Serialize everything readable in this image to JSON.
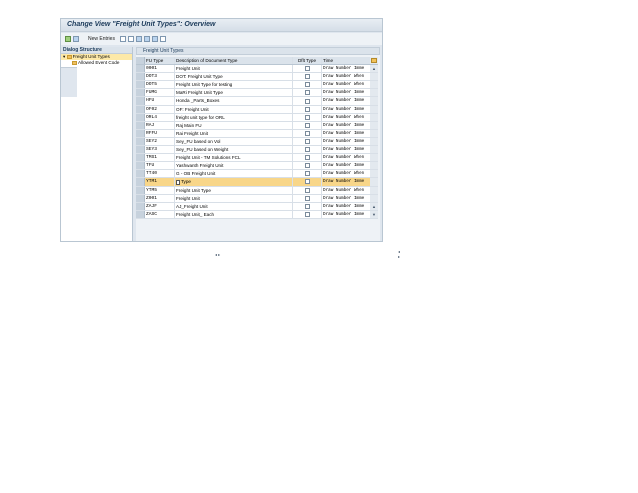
{
  "window": {
    "title": "Change View \"Freight Unit Types\": Overview"
  },
  "toolbar": {
    "new_entries": "New Entries"
  },
  "dialog": {
    "header": "Dialog Structure",
    "items": [
      {
        "label": "Freight Unit Types"
      },
      {
        "label": "Allowed Event Code"
      }
    ]
  },
  "table": {
    "title": "Freight Unit Types",
    "columns": {
      "code": "FU Type",
      "desc": "Description of Document Type",
      "dflt": "Dflt Type",
      "time": "Time"
    },
    "rows": [
      {
        "code": "0001",
        "desc": "Freight Unit",
        "time": "Draw Number Imme",
        "scroll": "▲"
      },
      {
        "code": "DOT3",
        "desc": "DOT: Freight Unit Type",
        "time": "Draw Number When",
        "scroll": ""
      },
      {
        "code": "DOT5",
        "desc": "Freight Unit Type for testing",
        "time": "Draw Number When",
        "scroll": ""
      },
      {
        "code": "FUMG",
        "desc": "MaRi Freight Unit Type",
        "time": "Draw Number Imme",
        "scroll": ""
      },
      {
        "code": "HFU",
        "desc": "Honda _Parts_Boxes",
        "time": "Draw Number Imme",
        "scroll": ""
      },
      {
        "code": "OF02",
        "desc": "OF: Freight Unit",
        "time": "Draw Number Imme",
        "scroll": ""
      },
      {
        "code": "ORL4",
        "desc": "freight unit type for ORL",
        "time": "Draw Number When",
        "scroll": ""
      },
      {
        "code": "RAJ",
        "desc": "Raj Main FU",
        "time": "Draw Number Imme",
        "scroll": ""
      },
      {
        "code": "RFFU",
        "desc": "Rai Freight Unit",
        "time": "Draw Number Imme",
        "scroll": ""
      },
      {
        "code": "SEY2",
        "desc": "Sey_FU based on Vol",
        "time": "Draw Number Imme",
        "scroll": ""
      },
      {
        "code": "SEY3",
        "desc": "Sey_FU based on Weight",
        "time": "Draw Number Imme",
        "scroll": ""
      },
      {
        "code": "TMS1",
        "desc": "Freight Unit - TM Solutions FCL",
        "time": "Draw Number When",
        "scroll": ""
      },
      {
        "code": "TFU",
        "desc": "Yashwanth Freight Unit",
        "time": "Draw Number Imme",
        "scroll": ""
      },
      {
        "code": "TT40",
        "desc": "G - OB Freight Unit",
        "time": "Draw Number When",
        "scroll": ""
      },
      {
        "code": "YTM1",
        "desc": "Type",
        "time": "Draw Number Imme",
        "scroll": "",
        "selected": true
      },
      {
        "code": "YTM5",
        "desc": "Freight Unit Type",
        "time": "Draw Number When",
        "scroll": ""
      },
      {
        "code": "Z001",
        "desc": "Freight Unit",
        "time": "Draw Number Imme",
        "scroll": ""
      },
      {
        "code": "ZAJF",
        "desc": "AJ_Freight Unit",
        "time": "Draw Number Imme",
        "scroll": "▲"
      },
      {
        "code": "ZASC",
        "desc": "Freight Unit_ Each",
        "time": "Draw Number Imme",
        "scroll": "▼"
      }
    ]
  },
  "scroll": {
    "left": "◂ ▸",
    "right": "◂ ▸"
  },
  "colors": {
    "selected_row": "#f8d689",
    "header": "#dbe3eb",
    "title": "#1b3a5a"
  },
  "icons": [
    "check-icon",
    "change-display-icon",
    "copy-icon",
    "delete-icon",
    "undo-icon",
    "select-all-icon",
    "select-block-icon",
    "deselect-all-icon",
    "table-settings-icon",
    "folder-icon"
  ]
}
